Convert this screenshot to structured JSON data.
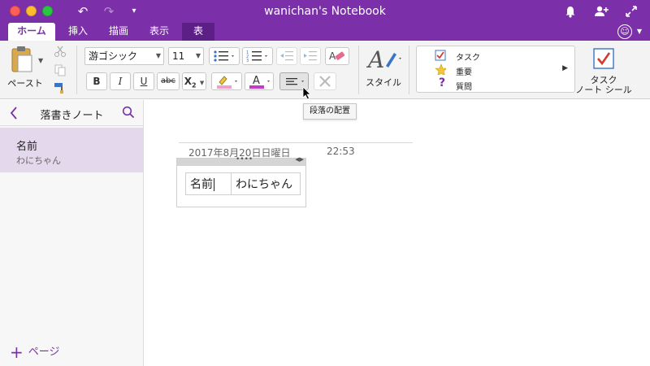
{
  "window": {
    "title": "wanichan's Notebook"
  },
  "tabs": [
    {
      "label": "ホーム"
    },
    {
      "label": "挿入"
    },
    {
      "label": "描画"
    },
    {
      "label": "表示"
    },
    {
      "label": "表"
    }
  ],
  "ribbon": {
    "paste_label": "ペースト",
    "font_name": "游ゴシック",
    "font_size": "11",
    "bold": "B",
    "italic": "I",
    "underline": "U",
    "strike": "abc",
    "subscript": "X",
    "subscript_index": "2",
    "font_color_glyph": "A",
    "style_label": "スタイル",
    "tags": [
      {
        "label": "タスク",
        "icon": "checkbox-icon"
      },
      {
        "label": "重要",
        "icon": "star-icon"
      },
      {
        "label": "質問",
        "icon": "question-icon"
      }
    ],
    "task_tag_label_1": "タスク",
    "task_tag_label_2": "ノート シール"
  },
  "tooltip": "段落の配置",
  "sidebar": {
    "title": "落書きノート",
    "pages": [
      {
        "title": "名前",
        "preview": "わにちゃん"
      }
    ],
    "add_page_label": "ページ"
  },
  "note": {
    "date": "2017年8月20日日曜日",
    "time": "22:53",
    "table": [
      [
        "名前",
        "わにちゃん"
      ]
    ]
  },
  "colors": {
    "accent": "#7b2fa8",
    "selected_page": "#e4d9ec",
    "highlight": "#f0a0c8",
    "font_color": "#c33cc9"
  }
}
